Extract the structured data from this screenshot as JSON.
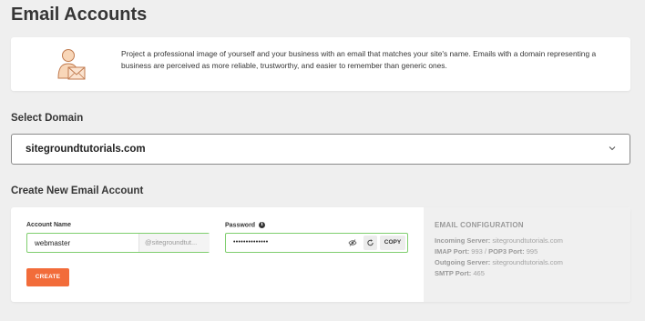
{
  "page_title": "Email Accounts",
  "intro": {
    "icon": "user-envelope-icon",
    "text": "Project a professional image of yourself and your business with an email that matches your site's name. Emails with a domain representing a business are perceived as more reliable, trustworthy, and easier to remember than generic ones."
  },
  "select_domain": {
    "label": "Select Domain",
    "value": "sitegroundtutorials.com"
  },
  "create": {
    "label": "Create New Email Account",
    "account_label": "Account Name",
    "account_value": "webmaster",
    "account_suffix": "@sitegroundtut...",
    "password_label": "Password",
    "password_value": "••••••••••••••",
    "copy_label": "COPY",
    "create_label": "CREATE"
  },
  "config": {
    "title": "EMAIL CONFIGURATION",
    "incoming_label": "Incoming Server:",
    "incoming_value": "sitegroundtutorials.com",
    "imap_label": "IMAP Port:",
    "imap_value": "993",
    "pop3_label": "POP3 Port:",
    "pop3_value": "995",
    "outgoing_label": "Outgoing Server:",
    "outgoing_value": "sitegroundtutorials.com",
    "smtp_label": "SMTP Port:",
    "smtp_value": "465"
  },
  "colors": {
    "accent": "#f26c3a",
    "valid_border": "#7fce6e",
    "background": "#efefef"
  }
}
